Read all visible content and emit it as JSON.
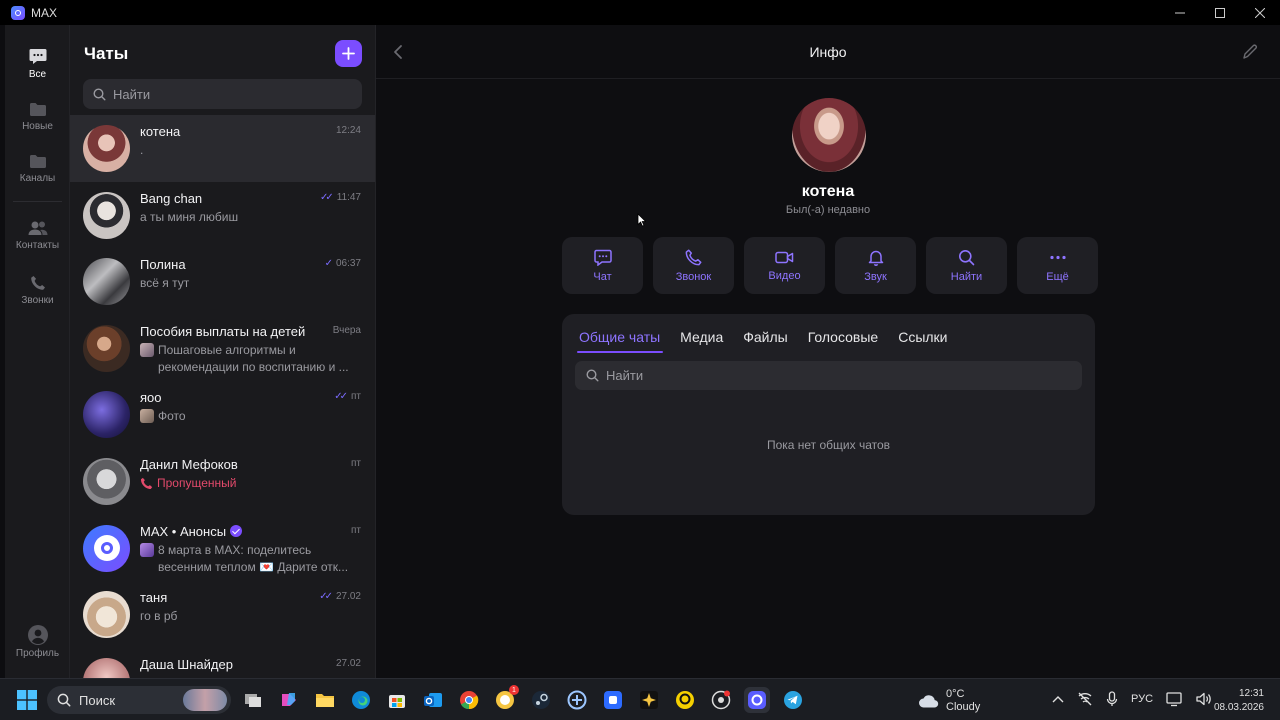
{
  "window": {
    "title": "MAX",
    "controls": [
      "minimize",
      "maximize",
      "close"
    ]
  },
  "rail": {
    "items": [
      {
        "label": "Все",
        "icon": "chat-bubble-icon",
        "active": true
      },
      {
        "label": "Новые",
        "icon": "folder-icon"
      },
      {
        "label": "Каналы",
        "icon": "folder-icon"
      },
      {
        "label": "Контакты",
        "icon": "contacts-icon"
      },
      {
        "label": "Звонки",
        "icon": "phone-icon"
      }
    ],
    "profile_label": "Профиль"
  },
  "chats": {
    "title": "Чаты",
    "search_placeholder": "Найти",
    "items": [
      {
        "name": "котена",
        "time": "12:24",
        "preview": ".",
        "selected": true
      },
      {
        "name": "Bang chan",
        "time": "11:47",
        "preview": "а ты миня любиш",
        "read": true
      },
      {
        "name": "Полина",
        "time": "06:37",
        "preview": "всё я тут",
        "read": true
      },
      {
        "name": "Пособия выплаты на детей",
        "time": "Вчера",
        "preview": "Пошаговые алгоритмы и рекомендации по воспитанию и ..."
      },
      {
        "name": "яоо",
        "time": "пт",
        "preview": "Фото",
        "read": true
      },
      {
        "name": "Данил Мефоков",
        "time": "пт",
        "preview": "Пропущенный",
        "missed_call": true
      },
      {
        "name": "MAX • Анонсы",
        "time": "пт",
        "preview": "8 марта в MAX: поделитесь весенним теплом 💌 Дарите отк...",
        "verified": true
      },
      {
        "name": "таня",
        "time": "27.02",
        "preview": "го в рб",
        "read": true
      },
      {
        "name": "Даша Шнайдер",
        "time": "27.02",
        "preview": ""
      }
    ]
  },
  "info": {
    "title": "Инфо",
    "name": "котена",
    "status": "Был(-а) недавно",
    "actions": [
      "Чат",
      "Звонок",
      "Видео",
      "Звук",
      "Найти",
      "Ещё"
    ],
    "tabs": [
      "Общие чаты",
      "Медиа",
      "Файлы",
      "Голосовые",
      "Ссылки"
    ],
    "active_tab": "Общие чаты",
    "search_placeholder": "Найти",
    "empty_text": "Пока нет общих чатов"
  },
  "taskbar": {
    "search_placeholder": "Поиск",
    "weather_temp": "0°C",
    "weather_desc": "Cloudy",
    "language": "РУС",
    "time": "12:31",
    "date": "08.03.2026",
    "badge_count": "1"
  },
  "colors": {
    "accent": "#7b4dff",
    "accent_text": "#8e74ff",
    "missed": "#e24a6b",
    "bg": "#0e0e11",
    "panel": "#1a1a1d"
  }
}
